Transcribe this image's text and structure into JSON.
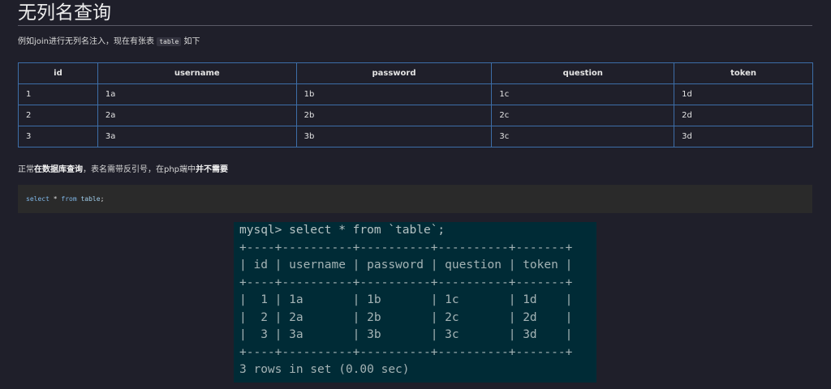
{
  "heading": "无列名查询",
  "intro": {
    "before": "例如join进行无列名注入，现在有张表",
    "code": "table",
    "after": "如下"
  },
  "table": {
    "headers": [
      "id",
      "username",
      "password",
      "question",
      "token"
    ],
    "rows": [
      [
        "1",
        "1a",
        "1b",
        "1c",
        "1d"
      ],
      [
        "2",
        "2a",
        "2b",
        "2c",
        "2d"
      ],
      [
        "3",
        "3a",
        "3b",
        "3c",
        "3d"
      ]
    ]
  },
  "para2": {
    "p1": "正常",
    "b1": "在数据库查询",
    "p2": "，表名需带反引号，在php端中",
    "b2": "并不需要"
  },
  "code_block": {
    "kw1": "select",
    "op": "*",
    "kw2": "from",
    "ident": "table",
    "end": ";"
  },
  "terminal": {
    "prompt": "mysql> select * from `table`;",
    "border": "+----+----------+----------+----------+-------+",
    "header_line": "| id | username | password | question | token |",
    "row_lines": [
      "|  1 | 1a       | 1b       | 1c       | 1d    |",
      "|  2 | 2a       | 2b       | 2c       | 2d    |",
      "|  3 | 3a       | 3b       | 3c       | 3d    |"
    ],
    "footer": "3 rows in set (0.00 sec)"
  }
}
